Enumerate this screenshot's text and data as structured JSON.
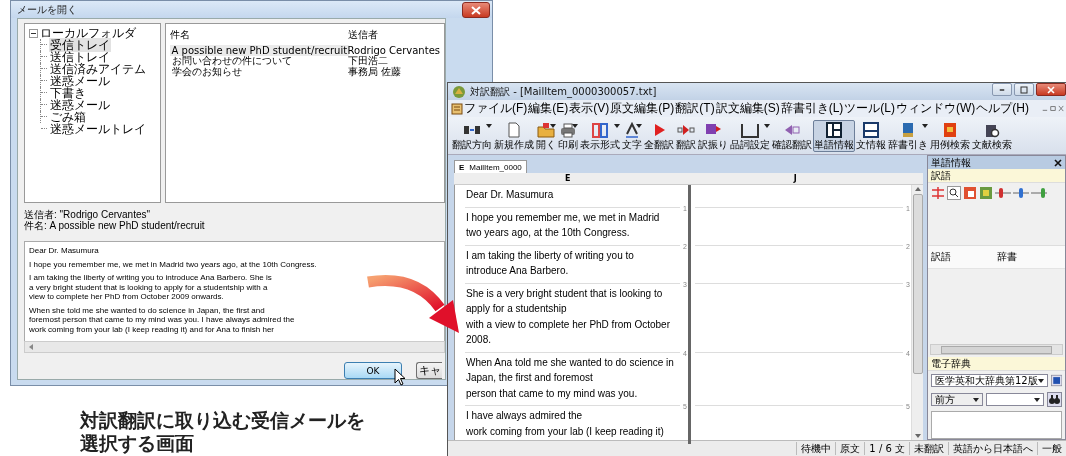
{
  "mail_dialog": {
    "title": "メールを開く",
    "folder_tree": {
      "label": "ローカルフォルダ",
      "expanded": true,
      "children": [
        {
          "label": "受信トレイ",
          "selected": true
        },
        {
          "label": "送信トレイ",
          "selected": false
        },
        {
          "label": "送信済みアイテム",
          "selected": false
        },
        {
          "label": "迷惑メール",
          "selected": false
        },
        {
          "label": "下書き",
          "selected": false
        },
        {
          "label": "迷惑メール",
          "selected": false
        },
        {
          "label": "ごみ箱",
          "selected": false
        },
        {
          "label": "迷惑メールトレイ",
          "selected": false
        }
      ]
    },
    "message_list": {
      "columns": [
        "件名",
        "送信者"
      ],
      "rows": [
        {
          "subject": "A possible new PhD student/recruit",
          "sender": "Rodrigo Cervantes",
          "selected": true
        },
        {
          "subject": "お問い合わせの件について",
          "sender": "下田浩二",
          "selected": false
        },
        {
          "subject": "学会のお知らせ",
          "sender": "事務局 佐藤",
          "selected": false
        }
      ]
    },
    "header_info": [
      "送信者: \"Rodrigo Cervantes\"",
      "件名: A possible new PhD student/recruit"
    ],
    "body_paragraphs": [
      [
        "Dear Dr. Masumura"
      ],
      [
        "I hope you remember me, we met in Madrid two years ago, at the 10th Congress."
      ],
      [
        "I am taking the liberty of writing you to introduce Ana Barbero.  She is",
        "a very bright student that is looking to apply for a studentship with a",
        "view to complete her PhD from October 2009 onwards."
      ],
      [
        "When she told me she wanted to do science in Japan, the first and",
        "foremost person that came to my mind was you.  I have always admired the",
        "work coming from your lab (I keep reading it) and for Ana to finish her"
      ]
    ],
    "buttons": [
      {
        "label": "OK",
        "default": true
      },
      {
        "label": "キャ",
        "default": false
      }
    ]
  },
  "translator_window": {
    "title": "対訳翻訳 - [MailItem_0000300057.txt]",
    "menu": [
      "ファイル(F)",
      "編集(E)",
      "表示(V)",
      "原文編集(P)",
      "翻訳(T)",
      "訳文編集(S)",
      "辞書引き(L)",
      "ツール(L)",
      "ウィンドウ(W)",
      "ヘルプ(H)"
    ],
    "toolbar": [
      {
        "label": "翻訳方向",
        "has_menu": true,
        "selected": false
      },
      {
        "label": "新規作成",
        "has_menu": false,
        "selected": false
      },
      {
        "label": "開く",
        "has_menu": true,
        "selected": false
      },
      {
        "label": "印刷",
        "has_menu": true,
        "selected": false
      },
      {
        "label": "表示形式",
        "has_menu": true,
        "selected": false
      },
      {
        "label": "文字",
        "has_menu": true,
        "selected": false
      },
      {
        "label": "全翻訳",
        "has_menu": false,
        "selected": false
      },
      {
        "label": "翻訳",
        "has_menu": false,
        "selected": false
      },
      {
        "label": "訳振り",
        "has_menu": false,
        "selected": false
      },
      {
        "label": "品詞設定",
        "has_menu": true,
        "selected": false
      },
      {
        "label": "確認翻訳",
        "has_menu": false,
        "selected": false
      },
      {
        "label": "単語情報",
        "has_menu": false,
        "selected": true
      },
      {
        "label": "文情報",
        "has_menu": false,
        "selected": false
      },
      {
        "label": "辞書引き",
        "has_menu": true,
        "selected": false
      },
      {
        "label": "用例検索",
        "has_menu": false,
        "selected": false
      },
      {
        "label": "文献検索",
        "has_menu": false,
        "selected": false
      }
    ],
    "document_tab": {
      "badge": "E",
      "label": "MailItem_0000"
    },
    "columns": [
      "E",
      "J"
    ],
    "segments": [
      {
        "source_lines": [
          "Dear Dr. Masumura"
        ],
        "number": "1",
        "target_number": "1"
      },
      {
        "source_lines": [
          "I hope you remember me, we met in Madrid",
          "two years ago, at the 10th Congress."
        ],
        "number": "2",
        "target_number": "2"
      },
      {
        "source_lines": [
          "I am taking the liberty of writing you to",
          "introduce Ana Barbero."
        ],
        "number": "3",
        "target_number": "3"
      },
      {
        "source_lines": [
          "She is a very bright student that is looking to",
          "apply for a studentship",
          "with a view to complete her PhD from October",
          "2008."
        ],
        "number": "4",
        "target_number": "4"
      },
      {
        "source_lines": [
          "When Ana told me she wanted to do science in",
          "Japan, the first and foremost",
          "person that came to my mind was you."
        ],
        "number": "5",
        "target_number": "5"
      },
      {
        "source_lines": [
          "I have always admired the",
          "work coming from your lab (I keep reading it)"
        ]
      }
    ],
    "word_panel": {
      "title": "単語情報",
      "translation_label": "訳語",
      "list_columns": [
        "訳語",
        "辞書"
      ],
      "dictionary_label": "電子辞典",
      "dictionary": "医学英和大辞典第12版",
      "search_mode": "前方"
    },
    "status_bar": [
      "待機中",
      "原文",
      "1 / 6 文",
      "未翻訳",
      "英語から日本語へ",
      "一般"
    ]
  },
  "caption_lines": [
    "対訳翻訳に取り込む受信メールを",
    "選択する画面"
  ]
}
